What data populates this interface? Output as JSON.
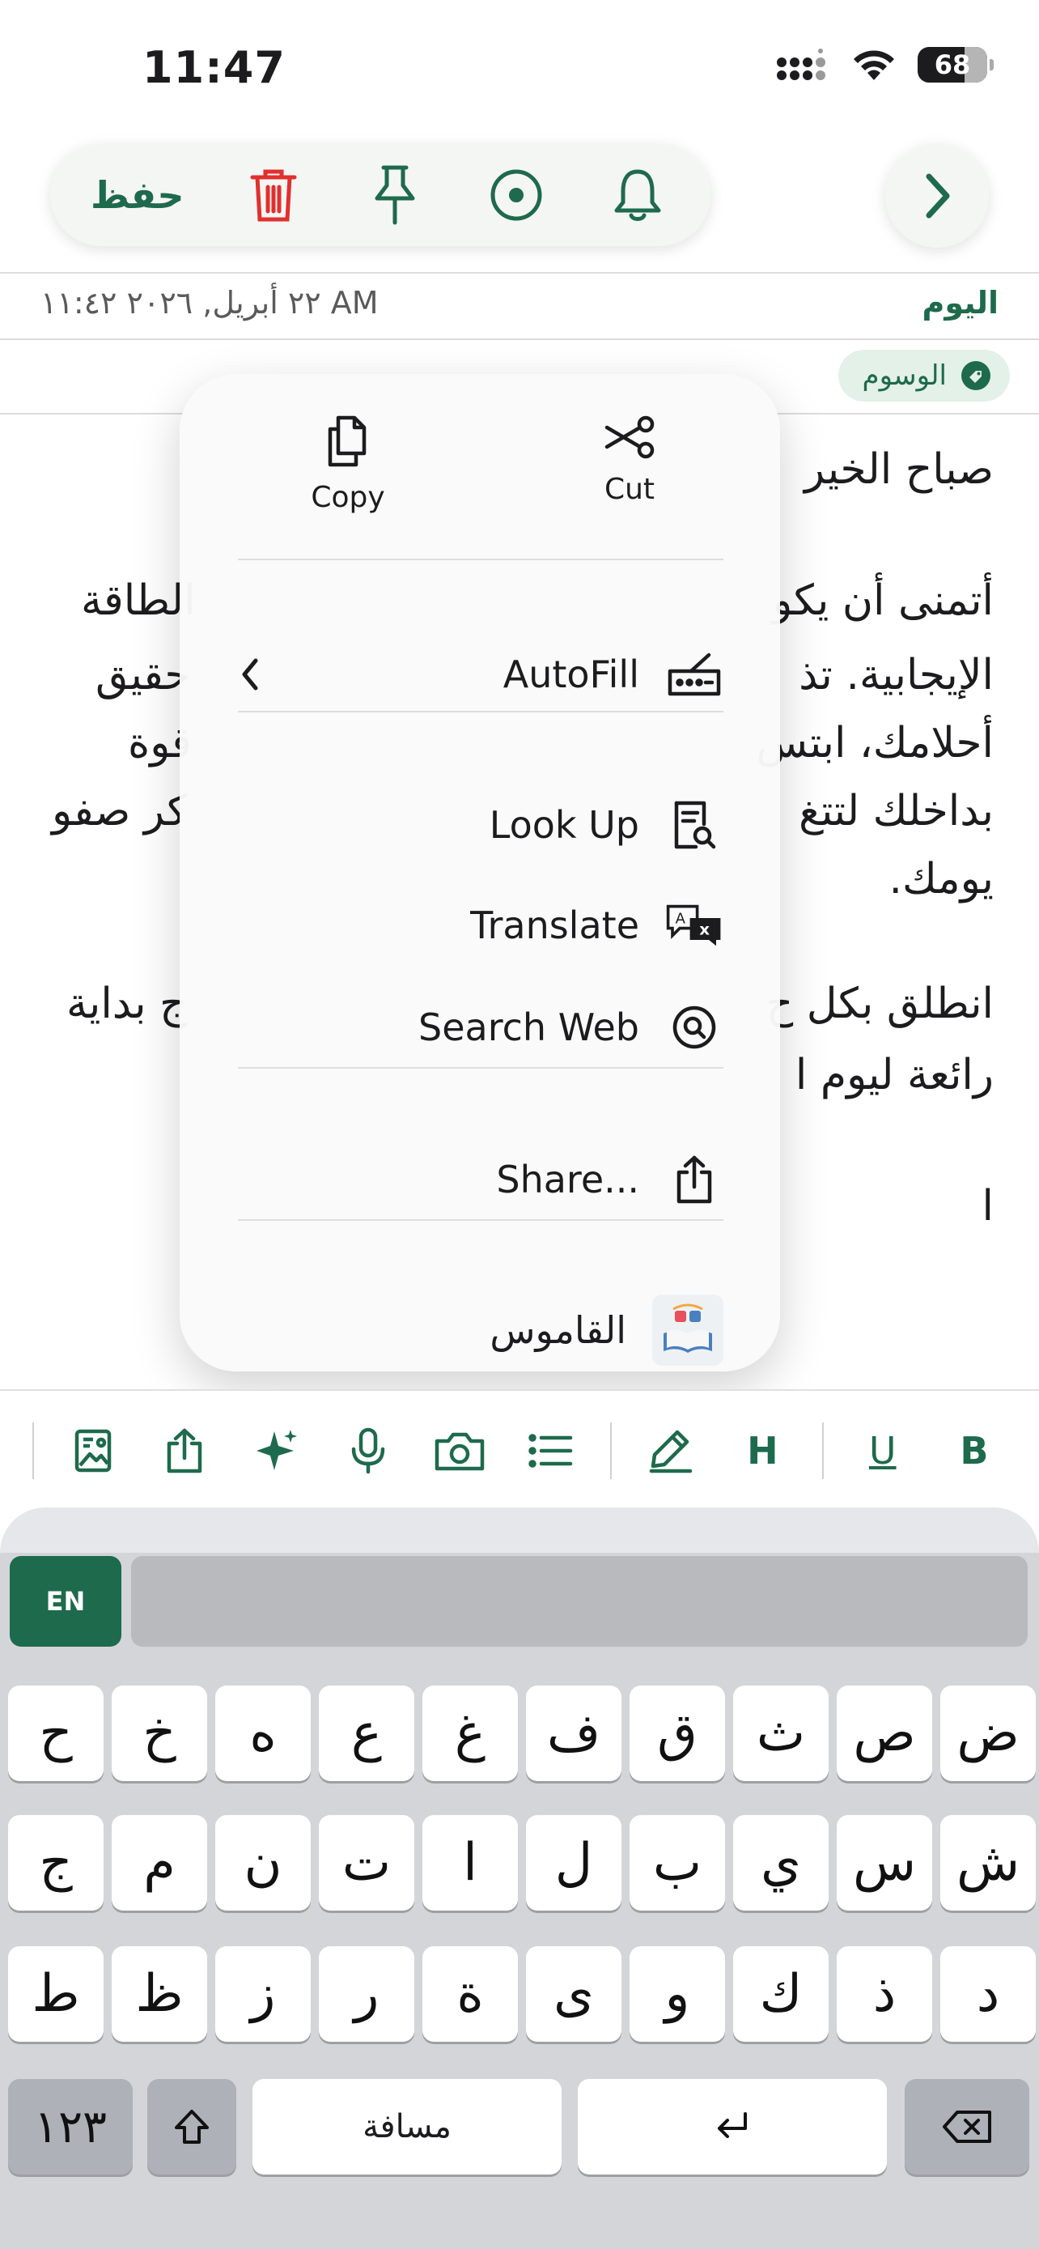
{
  "status": {
    "time": "11:47",
    "battery": "68"
  },
  "toolbar": {
    "save_label": "حفظ",
    "icons": [
      "trash-icon",
      "pin-icon",
      "record-icon",
      "bell-icon"
    ],
    "next_icon": "chevron-right-icon"
  },
  "meta": {
    "date": "٢٢ أبريل, ٢٠٢٦ ١١:٤٢ AM",
    "today": "اليوم",
    "tags": "الوسوم"
  },
  "note": {
    "lines": [
      "صباح الخير",
      "أتمنى أن يكو",
      "الطاقة",
      "الإيجابية. تذ",
      "حقيق",
      "أحلامك، ابتس",
      "قوة",
      "بداخلك لتتغ",
      "كر صفو",
      "يومك.",
      "انطلق بكل ح",
      "ج بداية",
      "رائعة ليوم ا",
      "ا"
    ]
  },
  "menu": {
    "copy": "Copy",
    "cut": "Cut",
    "autofill": "AutoFill",
    "look_up": "Look Up",
    "translate": "Translate",
    "search_web": "Search Web",
    "share": "Share...",
    "dictionary": "القاموس"
  },
  "format_bar": {
    "heading": "H",
    "underline": "U",
    "bold": "B"
  },
  "keyboard": {
    "lang": "EN",
    "row1": [
      "ح",
      "خ",
      "ه",
      "ع",
      "غ",
      "ف",
      "ق",
      "ث",
      "ص",
      "ض"
    ],
    "row2": [
      "ج",
      "م",
      "ن",
      "ت",
      "ا",
      "ل",
      "ب",
      "ي",
      "س",
      "ش"
    ],
    "row3": [
      "ط",
      "ظ",
      "ز",
      "ر",
      "ة",
      "ى",
      "و",
      "ك",
      "ذ",
      "د"
    ],
    "numbers": "١٢٣",
    "space": "مسافة"
  },
  "colors": {
    "accent": "#1e6a4c",
    "delete": "#e0302e"
  }
}
